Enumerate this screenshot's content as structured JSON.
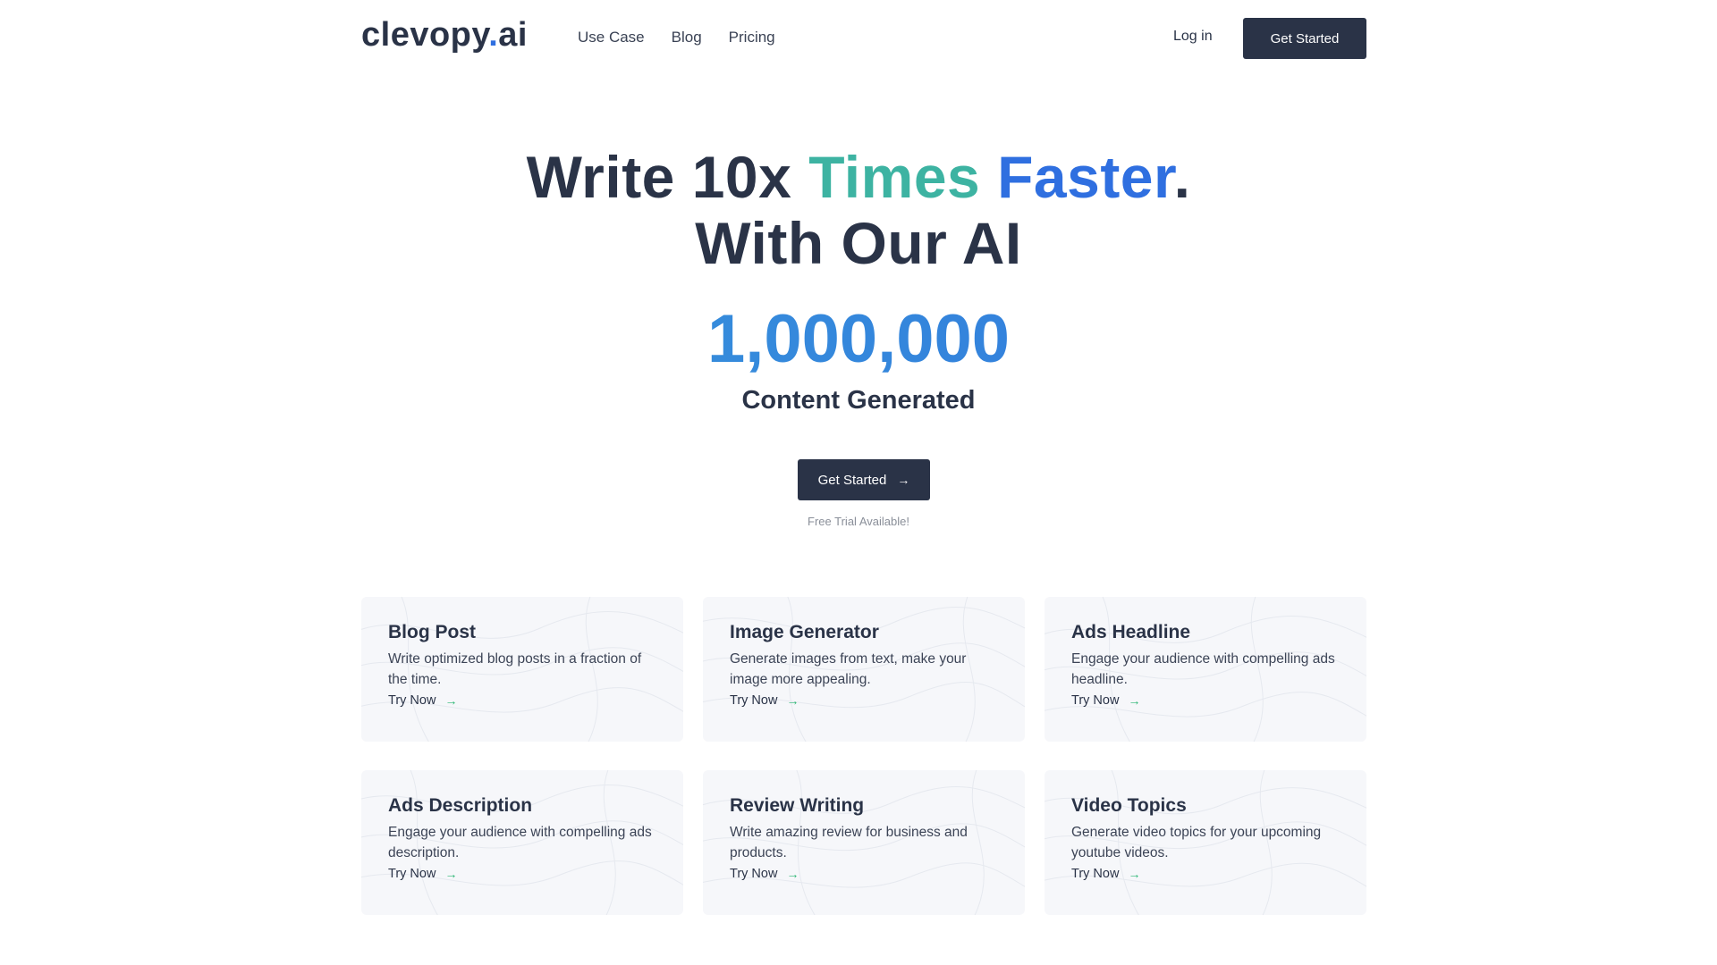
{
  "nav": {
    "logo_main": "clevopy",
    "logo_dot": ".",
    "logo_tld": "ai",
    "links": [
      "Use Case",
      "Blog",
      "Pricing"
    ],
    "login": "Log in",
    "cta": "Get Started"
  },
  "hero": {
    "line1_a": "Write 10x ",
    "line1_b": "Times",
    "line1_c": "Faster",
    "line1_d": ".",
    "line2": "With Our AI",
    "counter": "1,000,000",
    "counter_label": "Content Generated",
    "cta": "Get Started",
    "cta_icon": "arrow-right-icon",
    "trial": "Free Trial Available!"
  },
  "cards": [
    {
      "title": "Blog Post",
      "desc": "Write optimized blog posts in a fraction of the time.",
      "link": "Try Now"
    },
    {
      "title": "Image Generator",
      "desc": "Generate images from text, make your image more appealing.",
      "link": "Try Now"
    },
    {
      "title": "Ads Headline",
      "desc": "Engage your audience with compelling ads headline.",
      "link": "Try Now"
    },
    {
      "title": "Ads Description",
      "desc": "Engage your audience with compelling ads description.",
      "link": "Try Now"
    },
    {
      "title": "Review Writing",
      "desc": "Write amazing review for business and products.",
      "link": "Try Now"
    },
    {
      "title": "Video Topics",
      "desc": "Generate video topics for your upcoming youtube videos.",
      "link": "Try Now"
    }
  ],
  "colors": {
    "dark": "#2a3347",
    "teal": "#3db3a2",
    "blue": "#2f6fe0",
    "green_arrow": "#2bb673",
    "card_bg": "#f6f7fa"
  }
}
